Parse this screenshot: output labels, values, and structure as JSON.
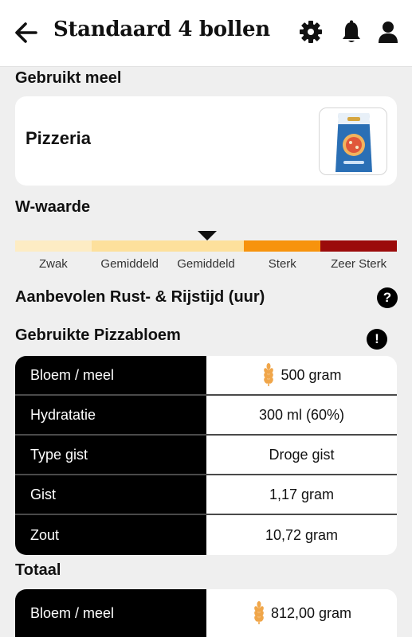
{
  "header": {
    "title": "Standaard 4 bollen"
  },
  "flour_section": {
    "title": "Gebruikt meel",
    "flour_name": "Pizzeria"
  },
  "w_value": {
    "title": "W-waarde",
    "selected_level_index": 2,
    "levels": [
      {
        "label": "Zwak",
        "color": "#fdecc4"
      },
      {
        "label": "Gemiddeld",
        "color": "#fde09c"
      },
      {
        "label": "Gemiddeld",
        "color": "#fde09c"
      },
      {
        "label": "Sterk",
        "color": "#f7930d"
      },
      {
        "label": "Zeer Sterk",
        "color": "#9b0b0b"
      }
    ]
  },
  "rest_time": {
    "title": "Aanbevolen Rust- & Rijstijd (uur)",
    "help_icon": "?"
  },
  "used_flour": {
    "title": "Gebruikte Pizzabloem",
    "info_icon": "!",
    "rows": [
      {
        "label": "Bloem / meel",
        "value": "500 gram",
        "icon": "wheat-icon"
      },
      {
        "label": "Hydratatie",
        "value": "300 ml (60%)"
      },
      {
        "label": "Type gist",
        "value": "Droge gist"
      },
      {
        "label": "Gist",
        "value": "1,17 gram"
      },
      {
        "label": "Zout",
        "value": "10,72 gram"
      }
    ]
  },
  "total": {
    "title": "Totaal",
    "rows": [
      {
        "label": "Bloem / meel",
        "value": "812,00 gram",
        "icon": "wheat-icon"
      }
    ]
  },
  "colors": {
    "header_bg": "#ffffff",
    "page_bg": "#efefef",
    "wheat": "#f0a64a"
  }
}
